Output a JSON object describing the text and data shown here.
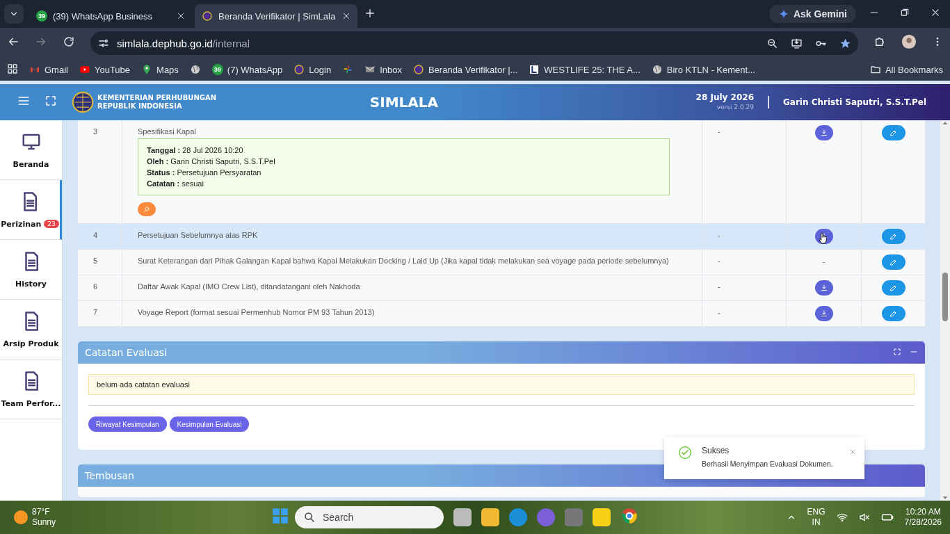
{
  "browser": {
    "tabs": [
      {
        "title": "(39) WhatsApp Business",
        "badge": "39",
        "selected": false
      },
      {
        "title": "Beranda Verifikator | SimLala",
        "selected": true
      }
    ],
    "ask_button": "Ask Gemini",
    "url_host": "simlala.dephub.go.id",
    "url_path": "/internal",
    "bookmarks": [
      {
        "label": "Gmail",
        "kind": "gmail"
      },
      {
        "label": "YouTube",
        "kind": "youtube"
      },
      {
        "label": "Maps",
        "kind": "maps"
      },
      {
        "kind": "globe"
      },
      {
        "label": "(7) WhatsApp",
        "kind": "whatsapp",
        "badge": "39"
      },
      {
        "label": "Login",
        "kind": "seal"
      },
      {
        "kind": "pinwheel"
      },
      {
        "label": "Inbox",
        "kind": "mail"
      },
      {
        "label": "Beranda Verifikator |...",
        "kind": "seal"
      },
      {
        "label": "WESTLIFE 25: THE A...",
        "kind": "letter"
      },
      {
        "label": "Biro KTLN - Kement...",
        "kind": "globe"
      }
    ],
    "all_bookmarks": "All Bookmarks"
  },
  "header": {
    "org_line1": "KEMENTERIAN PERHUBUNGAN",
    "org_line2": "REPUBLIK INDONESIA",
    "app_title": "SIMLALA",
    "date": "28 July 2026",
    "version": "versi 2.0.29",
    "user": "Garin Christi Saputri, S.S.T.Pel"
  },
  "sidebar": {
    "items": [
      {
        "label": "Beranda",
        "kind": "monitor",
        "selected": false
      },
      {
        "label": "Perizinan",
        "kind": "doc",
        "badge": "23",
        "selected": true
      },
      {
        "label": "History",
        "kind": "doc",
        "selected": false
      },
      {
        "label": "Arsip Produk",
        "kind": "doc",
        "selected": false
      },
      {
        "label": "Team Perfor...",
        "kind": "doc",
        "selected": false
      }
    ]
  },
  "documents": {
    "rows": [
      {
        "no": "3",
        "name": "Spesifikasi Kapal",
        "col3": "-",
        "download": true,
        "selected": false,
        "log": [
          {
            "label": "Tanggal :",
            "value": "28 Jul 2026 10:20"
          },
          {
            "label": "Oleh :",
            "value": "Garin Christi Saputri, S.S.T.Pel"
          },
          {
            "label": "Status :",
            "value": "Persetujuan Persyaratan"
          },
          {
            "label": "Catatan :",
            "value": "sesuai"
          }
        ]
      },
      {
        "no": "4",
        "name": "Persetujuan Sebelumnya atas RPK",
        "col3": "-",
        "download": true,
        "selected": true
      },
      {
        "no": "5",
        "name": "Surat Keterangan dari Pihak Galangan Kapal bahwa Kapal Melakukan Docking / Laid Up (Jika kapal tidak melakukan sea voyage pada periode sebelumnya)",
        "col3": "-",
        "download": false,
        "download_text": "-",
        "selected": false
      },
      {
        "no": "6",
        "name": "Daftar Awak Kapal (IMO Crew List), ditandatangani oleh Nakhoda",
        "col3": "-",
        "download": true,
        "selected": false
      },
      {
        "no": "7",
        "name": "Voyage Report (format sesuai Permenhub Nomor PM 93 Tahun 2013)",
        "col3": "-",
        "download": true,
        "selected": false
      }
    ]
  },
  "evaluation": {
    "title": "Catatan Evaluasi",
    "note": "belum ada catatan evaluasi",
    "buttons": [
      "Riwayat Kesimpulan",
      "Kesimpulan Evaluasi"
    ]
  },
  "tembusan": {
    "title": "Tembusan"
  },
  "toast": {
    "title": "Sukses",
    "message": "Berhasil Menyimpan Evaluasi Dokumen."
  },
  "taskbar": {
    "temperature": "87°F",
    "weather": "Sunny",
    "search": "Search",
    "lang": "ENG",
    "region": "IN",
    "time": "10:20 AM",
    "date": "7/28/2026"
  }
}
